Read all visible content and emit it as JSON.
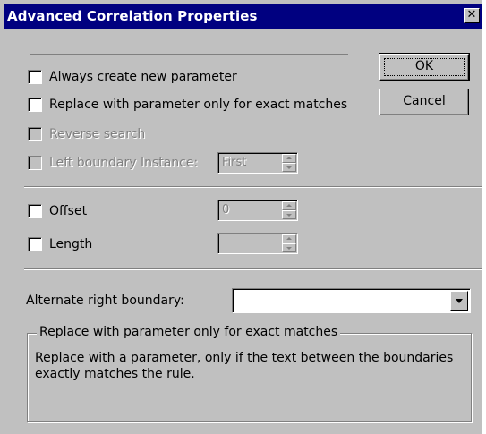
{
  "window": {
    "title": "Advanced Correlation Properties",
    "close_glyph": "✕"
  },
  "options": {
    "always_create": "Always create new parameter",
    "replace_exact": "Replace with parameter only for exact matches",
    "reverse_search": "Reverse search",
    "left_boundary_instance": "Left boundary Instance:",
    "offset": "Offset",
    "length": "Length"
  },
  "spins": {
    "left_boundary_value": "First",
    "offset_value": "0",
    "length_value": ""
  },
  "buttons": {
    "ok": "OK",
    "cancel": "Cancel"
  },
  "alternate": {
    "label": "Alternate right boundary:",
    "value": ""
  },
  "description": {
    "title": "Replace with parameter only for exact matches",
    "text": "Replace with a parameter, only if the text between the boundaries exactly matches the rule."
  }
}
